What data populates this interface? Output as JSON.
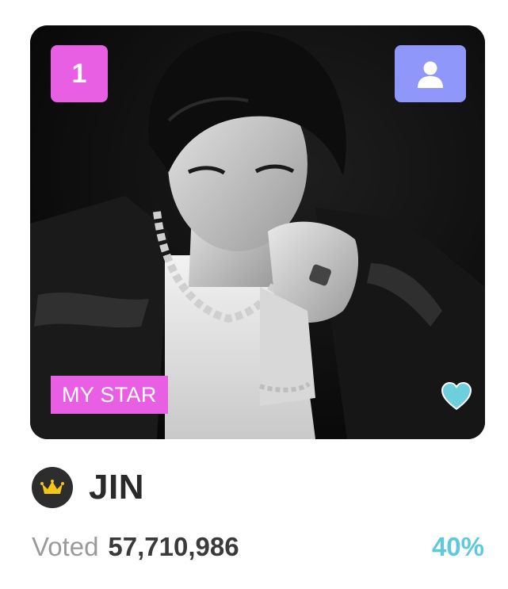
{
  "card": {
    "rank": "1",
    "tag_label": "MY STAR",
    "photo_description": "",
    "icons": {
      "profile": "user-icon",
      "favorite": "heart-icon",
      "crown": "crown-icon"
    },
    "colors": {
      "rank_badge": "#e85fe3",
      "profile_button": "#8f97fa",
      "tag": "#e85fe3",
      "heart": "#6ecfdc"
    }
  },
  "star": {
    "name": "JIN"
  },
  "votes": {
    "label": "Voted",
    "count": "57,710,986",
    "percent": "40%",
    "percent_color": "#5fc9dc"
  }
}
